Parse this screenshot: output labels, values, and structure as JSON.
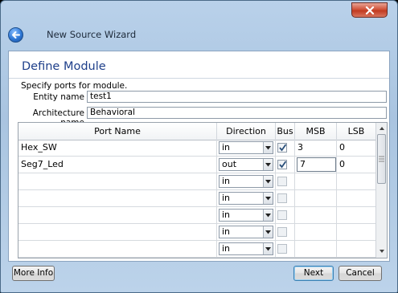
{
  "window": {
    "title": "New Source Wizard"
  },
  "page": {
    "heading": "Define Module",
    "subtitle": "Specify ports for module."
  },
  "fields": {
    "entity_label": "Entity name",
    "entity_value": "test1",
    "architecture_label": "Architecture name",
    "architecture_value": "Behavioral"
  },
  "table": {
    "columns": [
      "Port Name",
      "Direction",
      "Bus",
      "MSB",
      "LSB"
    ],
    "rows": [
      {
        "port": "Hex_SW",
        "direction": "in",
        "bus": true,
        "msb": "3",
        "lsb": "0"
      },
      {
        "port": "Seg7_Led",
        "direction": "out",
        "bus": true,
        "msb": "7",
        "lsb": "0"
      },
      {
        "port": "",
        "direction": "in",
        "bus": false,
        "msb": "",
        "lsb": ""
      },
      {
        "port": "",
        "direction": "in",
        "bus": false,
        "msb": "",
        "lsb": ""
      },
      {
        "port": "",
        "direction": "in",
        "bus": false,
        "msb": "",
        "lsb": ""
      },
      {
        "port": "",
        "direction": "in",
        "bus": false,
        "msb": "",
        "lsb": ""
      },
      {
        "port": "",
        "direction": "in",
        "bus": false,
        "msb": "",
        "lsb": ""
      }
    ]
  },
  "buttons": {
    "more_info": "More Info",
    "next": "Next",
    "cancel": "Cancel"
  },
  "icons": {
    "close": "close-icon",
    "back": "back-arrow-icon",
    "dropdown": "chevron-down-icon",
    "check": "checkmark-icon"
  },
  "colors": {
    "heading": "#1e3f8a",
    "close_button": "#c13a20",
    "frame": "#b9d1ea"
  }
}
